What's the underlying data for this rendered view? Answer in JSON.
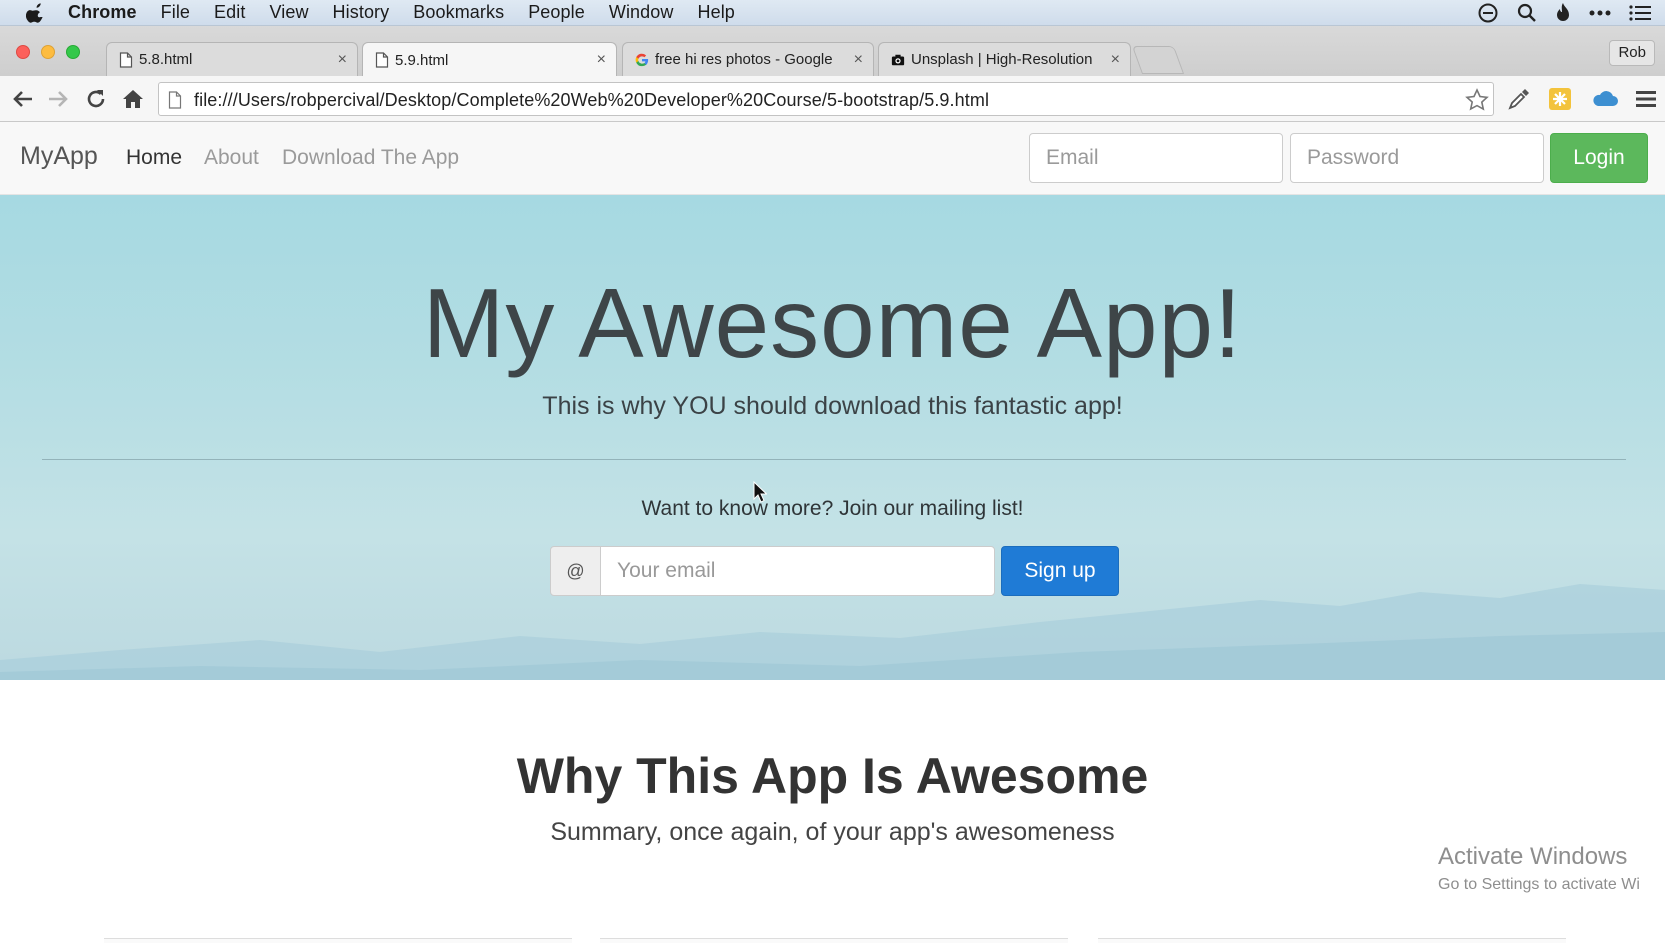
{
  "mac_menubar": {
    "app_name": "Chrome",
    "items": [
      "File",
      "Edit",
      "View",
      "History",
      "Bookmarks",
      "People",
      "Window",
      "Help"
    ],
    "right_icons": [
      "sync-icon",
      "spotlight-search-icon",
      "flame-icon",
      "more-icon",
      "notification-list-icon"
    ]
  },
  "browser": {
    "tabs": [
      {
        "title": "5.8.html",
        "icon": "page-icon",
        "active": false
      },
      {
        "title": "5.9.html",
        "icon": "page-icon",
        "active": true
      },
      {
        "title": "free hi res photos - Google",
        "icon": "google-icon",
        "active": false
      },
      {
        "title": "Unsplash | High-Resolution",
        "icon": "camera-icon",
        "active": false
      }
    ],
    "tab_close_glyph": "×",
    "profile_name": "Rob",
    "address": "file:///Users/robpercival/Desktop/Complete%20Web%20Developer%20Course/5-bootstrap/5.9.html"
  },
  "site_nav": {
    "brand": "MyApp",
    "links": [
      {
        "label": "Home",
        "active": true
      },
      {
        "label": "About",
        "active": false
      },
      {
        "label": "Download The App",
        "active": false
      }
    ],
    "email_placeholder": "Email",
    "password_placeholder": "Password",
    "login_label": "Login"
  },
  "hero": {
    "title": "My Awesome App!",
    "subtitle": "This is why YOU should download this fantastic app!",
    "mailing_prompt": "Want to know more? Join our mailing list!",
    "addon_symbol": "@",
    "email_placeholder": "Your email",
    "signup_label": "Sign up"
  },
  "section": {
    "title": "Why This App Is Awesome",
    "subtitle": "Summary, once again, of your app's awesomeness"
  },
  "watermark": {
    "title": "Activate Windows",
    "subtitle": "Go to Settings to activate Wi"
  },
  "colors": {
    "login_green": "#5cb85c",
    "signup_blue": "#1f7bd6",
    "hero_sky": "#a6d9e2"
  }
}
